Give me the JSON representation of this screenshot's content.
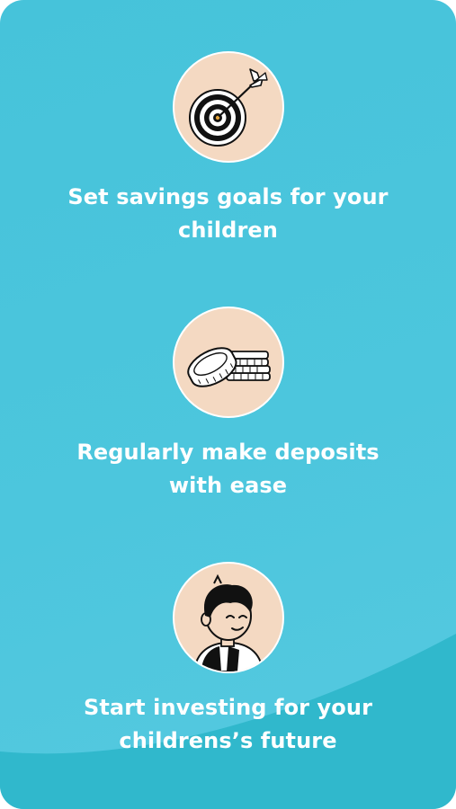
{
  "features": [
    {
      "icon": "target-icon",
      "text": "Set savings goals for your children"
    },
    {
      "icon": "coins-icon",
      "text": "Regularly make deposits with ease"
    },
    {
      "icon": "child-icon",
      "text": "Start investing for your childrens’s future"
    }
  ],
  "colors": {
    "background": "#4cc6dd",
    "wave": "#2fb6cb",
    "icon_circle": "#f4d9c2",
    "text": "#ffffff"
  }
}
